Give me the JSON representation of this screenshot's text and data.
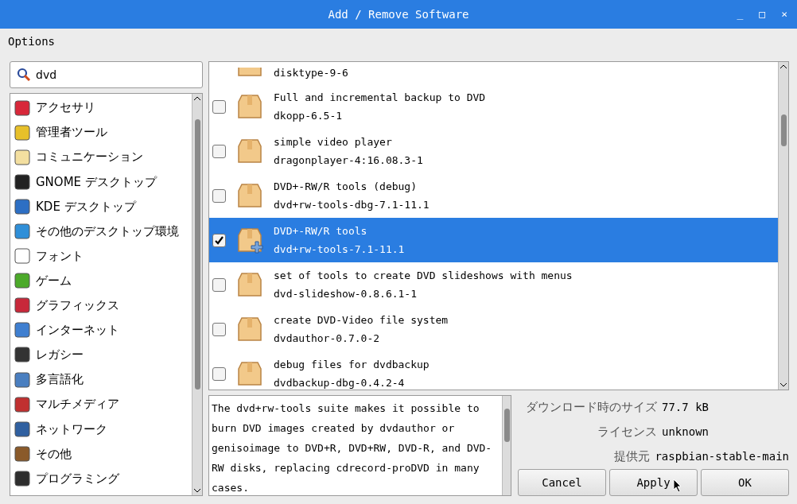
{
  "window": {
    "title": "Add / Remove Software",
    "controls": [
      "_",
      "□",
      "×"
    ]
  },
  "menu": [
    "Options"
  ],
  "search": {
    "value": "dvd"
  },
  "categories": [
    {
      "label": "アクセサリ"
    },
    {
      "label": "管理者ツール"
    },
    {
      "label": "コミュニケーション"
    },
    {
      "label": "GNOME デスクトップ"
    },
    {
      "label": "KDE デスクトップ"
    },
    {
      "label": "その他のデスクトップ環境"
    },
    {
      "label": "フォント"
    },
    {
      "label": "ゲーム"
    },
    {
      "label": "グラフィックス"
    },
    {
      "label": "インターネット"
    },
    {
      "label": "レガシー"
    },
    {
      "label": "多言語化"
    },
    {
      "label": "マルチメディア"
    },
    {
      "label": "ネットワーク"
    },
    {
      "label": "その他"
    },
    {
      "label": "プログラミング"
    }
  ],
  "packages": [
    {
      "package": "disktype-9-6",
      "selected": false
    },
    {
      "summary": "Full and incremental backup to DVD",
      "package": "dkopp-6.5-1",
      "checked": false,
      "selected": false
    },
    {
      "summary": "simple video player",
      "package": "dragonplayer-4:16.08.3-1",
      "checked": false,
      "selected": false
    },
    {
      "summary": "DVD+-RW/R tools (debug)",
      "package": "dvd+rw-tools-dbg-7.1-11.1",
      "checked": false,
      "selected": false
    },
    {
      "summary": "DVD+-RW/R tools",
      "package": "dvd+rw-tools-7.1-11.1",
      "checked": true,
      "selected": true
    },
    {
      "summary": "set of tools to create DVD slideshows with menus",
      "package": "dvd-slideshow-0.8.6.1-1",
      "checked": false,
      "selected": false
    },
    {
      "summary": "create DVD-Video file system",
      "package": "dvdauthor-0.7.0-2",
      "checked": false,
      "selected": false
    },
    {
      "summary": "debug files for dvdbackup",
      "package": "dvdbackup-dbg-0.4.2-4",
      "checked": false,
      "selected": false
    }
  ],
  "description": "The dvd+rw-tools suite makes it possible to burn DVD images created by dvdauthor or genisoimage to DVD+R, DVD+RW, DVD-R, and DVD-RW disks, replacing cdrecord-proDVD in many cases.",
  "details": [
    {
      "label": "ダウンロード時のサイズ",
      "value": "77.7 kB"
    },
    {
      "label": "ライセンス",
      "value": "unknown"
    },
    {
      "label": "提供元",
      "value": "raspbian-stable-main"
    }
  ],
  "buttons": [
    "Cancel",
    "Apply",
    "OK"
  ]
}
